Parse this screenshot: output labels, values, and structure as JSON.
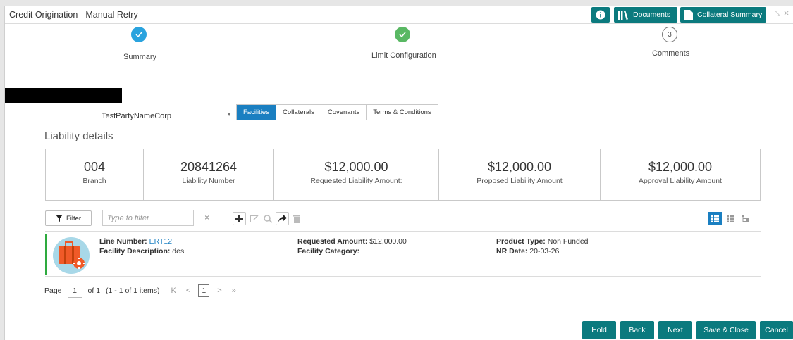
{
  "window": {
    "title": "Credit Origination - Manual Retry"
  },
  "header": {
    "documents_label": "Documents",
    "collateral_summary_label": "Collateral Summary"
  },
  "steps": [
    {
      "label": "Summary",
      "state": "done"
    },
    {
      "label": "Limit Configuration",
      "state": "done"
    },
    {
      "label": "Comments",
      "number": "3",
      "state": "pending"
    }
  ],
  "party": {
    "selected": "TestPartyNameCorp"
  },
  "tabs": [
    "Facilities",
    "Collaterals",
    "Covenants",
    "Terms & Conditions"
  ],
  "active_tab": "Facilities",
  "liability": {
    "heading": "Liability details",
    "cells": [
      {
        "value": "004",
        "label": "Branch"
      },
      {
        "value": "20841264",
        "label": "Liability Number"
      },
      {
        "value": "$12,000.00",
        "label": "Requested Liability Amount:"
      },
      {
        "value": "$12,000.00",
        "label": "Proposed Liability Amount"
      },
      {
        "value": "$12,000.00",
        "label": "Approval Liability Amount"
      }
    ]
  },
  "toolbar": {
    "filter_label": "Filter",
    "filter_placeholder": "Type to filter",
    "clear": "×"
  },
  "facility": {
    "line_number_label": "Line Number:",
    "line_number": "ERT12",
    "description_label": "Facility Description:",
    "description": "des",
    "requested_amount_label": "Requested Amount:",
    "requested_amount": "$12,000.00",
    "category_label": "Facility Category:",
    "category": "",
    "product_type_label": "Product Type:",
    "product_type": "Non Funded",
    "nr_date_label": "NR Date:",
    "nr_date": "20-03-26"
  },
  "pager": {
    "page_label": "Page",
    "page_value": "1",
    "of_label": "of 1",
    "items": "(1 - 1 of 1 items)",
    "current": "1",
    "first": "K",
    "prev": "<",
    "next": ">",
    "last": "»"
  },
  "footer": {
    "hold": "Hold",
    "back": "Back",
    "next": "Next",
    "save_close": "Save & Close",
    "cancel": "Cancel"
  },
  "colors": {
    "teal": "#0b7a7e",
    "blue": "#1a7fc1",
    "step_blue": "#2aa3de",
    "step_green": "#59b863",
    "accent_green": "#2eaa3f"
  }
}
